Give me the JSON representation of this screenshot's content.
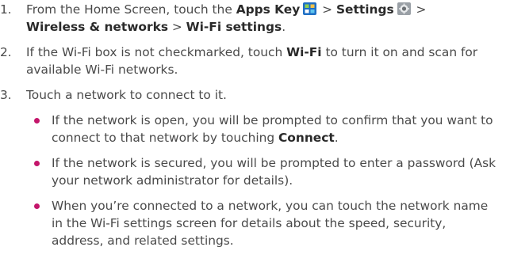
{
  "steps": [
    {
      "number": "1.",
      "parts": {
        "t1": "From the Home Screen, touch the ",
        "apps_key": "Apps Key",
        "t2": " > ",
        "settings": "Settings",
        "t3": " > ",
        "wireless": "Wireless & networks",
        "t4": " > ",
        "wifi_settings": "Wi-Fi settings",
        "t5": "."
      },
      "icons": [
        "apps-key-icon",
        "settings-gear-icon"
      ]
    },
    {
      "number": "2.",
      "parts": {
        "t1": "If the Wi-Fi box is not checkmarked, touch ",
        "wifi": "Wi-Fi",
        "t2": " to turn it on and scan for available Wi-Fi networks."
      }
    },
    {
      "number": "3.",
      "text": "Touch a network to connect to it.",
      "bullets": [
        {
          "t1": "If the network is open, you will be prompted to confirm that you want to connect to that network by touching ",
          "connect": "Connect",
          "t2": "."
        },
        {
          "t1": "If the network is secured, you will be prompted to enter a password (Ask your network administrator for details)."
        },
        {
          "t1": "When you’re connected to a network, you can touch the network name in the Wi-Fi settings screen for details about the speed, security, address, and related settings."
        }
      ]
    }
  ],
  "colors": {
    "text": "#4a4a4a",
    "bold_text": "#2a2a2a",
    "bullet": "#c4166b",
    "apps_icon_bg": "#1f6fc4",
    "apps_icon_tile": "#8fd14f"
  }
}
